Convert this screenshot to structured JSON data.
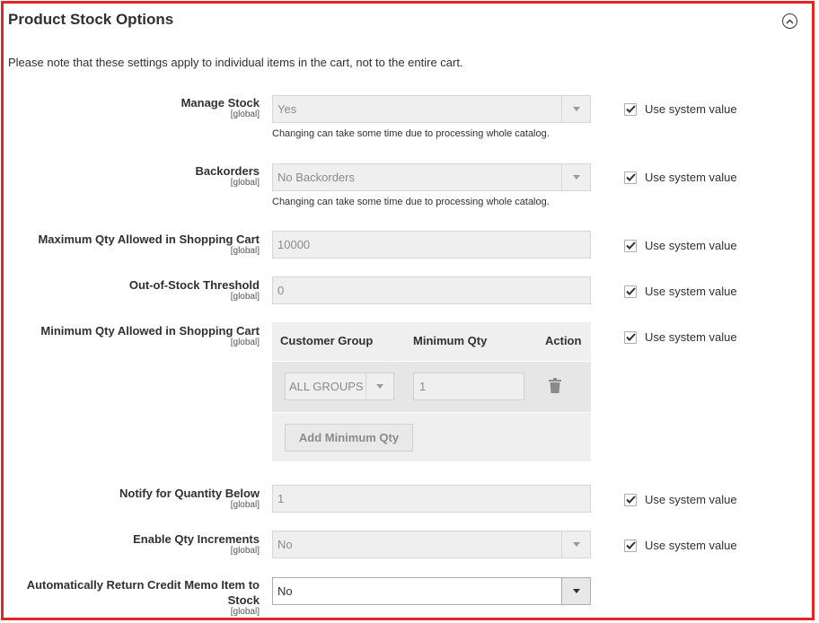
{
  "section": {
    "title": "Product Stock Options",
    "note": "Please note that these settings apply to individual items in the cart, not to the entire cart."
  },
  "system_value_label": "Use system value",
  "fields": {
    "manage_stock": {
      "label": "Manage Stock",
      "scope": "[global]",
      "value": "Yes",
      "hint": "Changing can take some time due to processing whole catalog."
    },
    "backorders": {
      "label": "Backorders",
      "scope": "[global]",
      "value": "No Backorders",
      "hint": "Changing can take some time due to processing whole catalog."
    },
    "max_qty": {
      "label": "Maximum Qty Allowed in Shopping Cart",
      "scope": "[global]",
      "value": "10000"
    },
    "oos_threshold": {
      "label": "Out-of-Stock Threshold",
      "scope": "[global]",
      "value": "0"
    },
    "min_qty": {
      "label": "Minimum Qty Allowed in Shopping Cart",
      "scope": "[global]",
      "columns": [
        "Customer Group",
        "Minimum Qty",
        "Action"
      ],
      "row": {
        "group": "ALL GROUPS",
        "qty": "1"
      },
      "add_button": "Add Minimum Qty"
    },
    "notify_qty": {
      "label": "Notify for Quantity Below",
      "scope": "[global]",
      "value": "1"
    },
    "qty_increments": {
      "label": "Enable Qty Increments",
      "scope": "[global]",
      "value": "No"
    },
    "return_credit_memo": {
      "label_line1": "Automatically Return Credit Memo Item to",
      "label_line2": "Stock",
      "scope": "[global]",
      "value": "No"
    }
  },
  "colors": {
    "frame_border": "#e22626",
    "disabled_bg": "#efefef",
    "text": "#303030"
  }
}
